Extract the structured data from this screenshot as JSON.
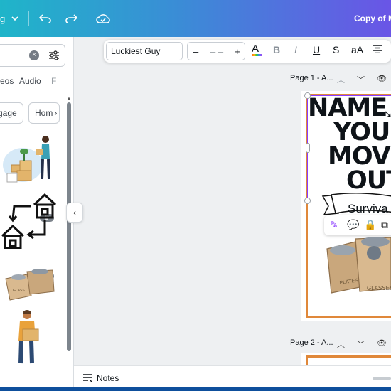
{
  "topbar": {
    "menu_label": "g",
    "doc_title": "Copy of M"
  },
  "left_panel": {
    "tabs": [
      "eos",
      "Audio",
      "F"
    ],
    "chips": [
      "gage",
      "Hom"
    ],
    "pro_badge": "♛"
  },
  "toolbar": {
    "font_name": "Luckiest Guy",
    "size_minus": "–",
    "size_value": "– –",
    "size_plus": "+",
    "text_color_label": "A",
    "bold_label": "B",
    "italic_label": "I",
    "underline_label": "U",
    "strikethrough_label": "S",
    "case_label": "aA"
  },
  "pages": [
    {
      "label": "Page 1 - A...",
      "title_lines": [
        "NAME",
        "YOU'",
        "MOV",
        "OUT"
      ],
      "ribbon_text": "Surviva"
    },
    {
      "label": "Page 2 - A..."
    }
  ],
  "notes": {
    "label": "Notes"
  },
  "colors": {
    "gradient_start": "#1fb5c9",
    "gradient_end": "#6a55e6",
    "selection": "#8b3dff",
    "page_border": "#e0883a"
  }
}
